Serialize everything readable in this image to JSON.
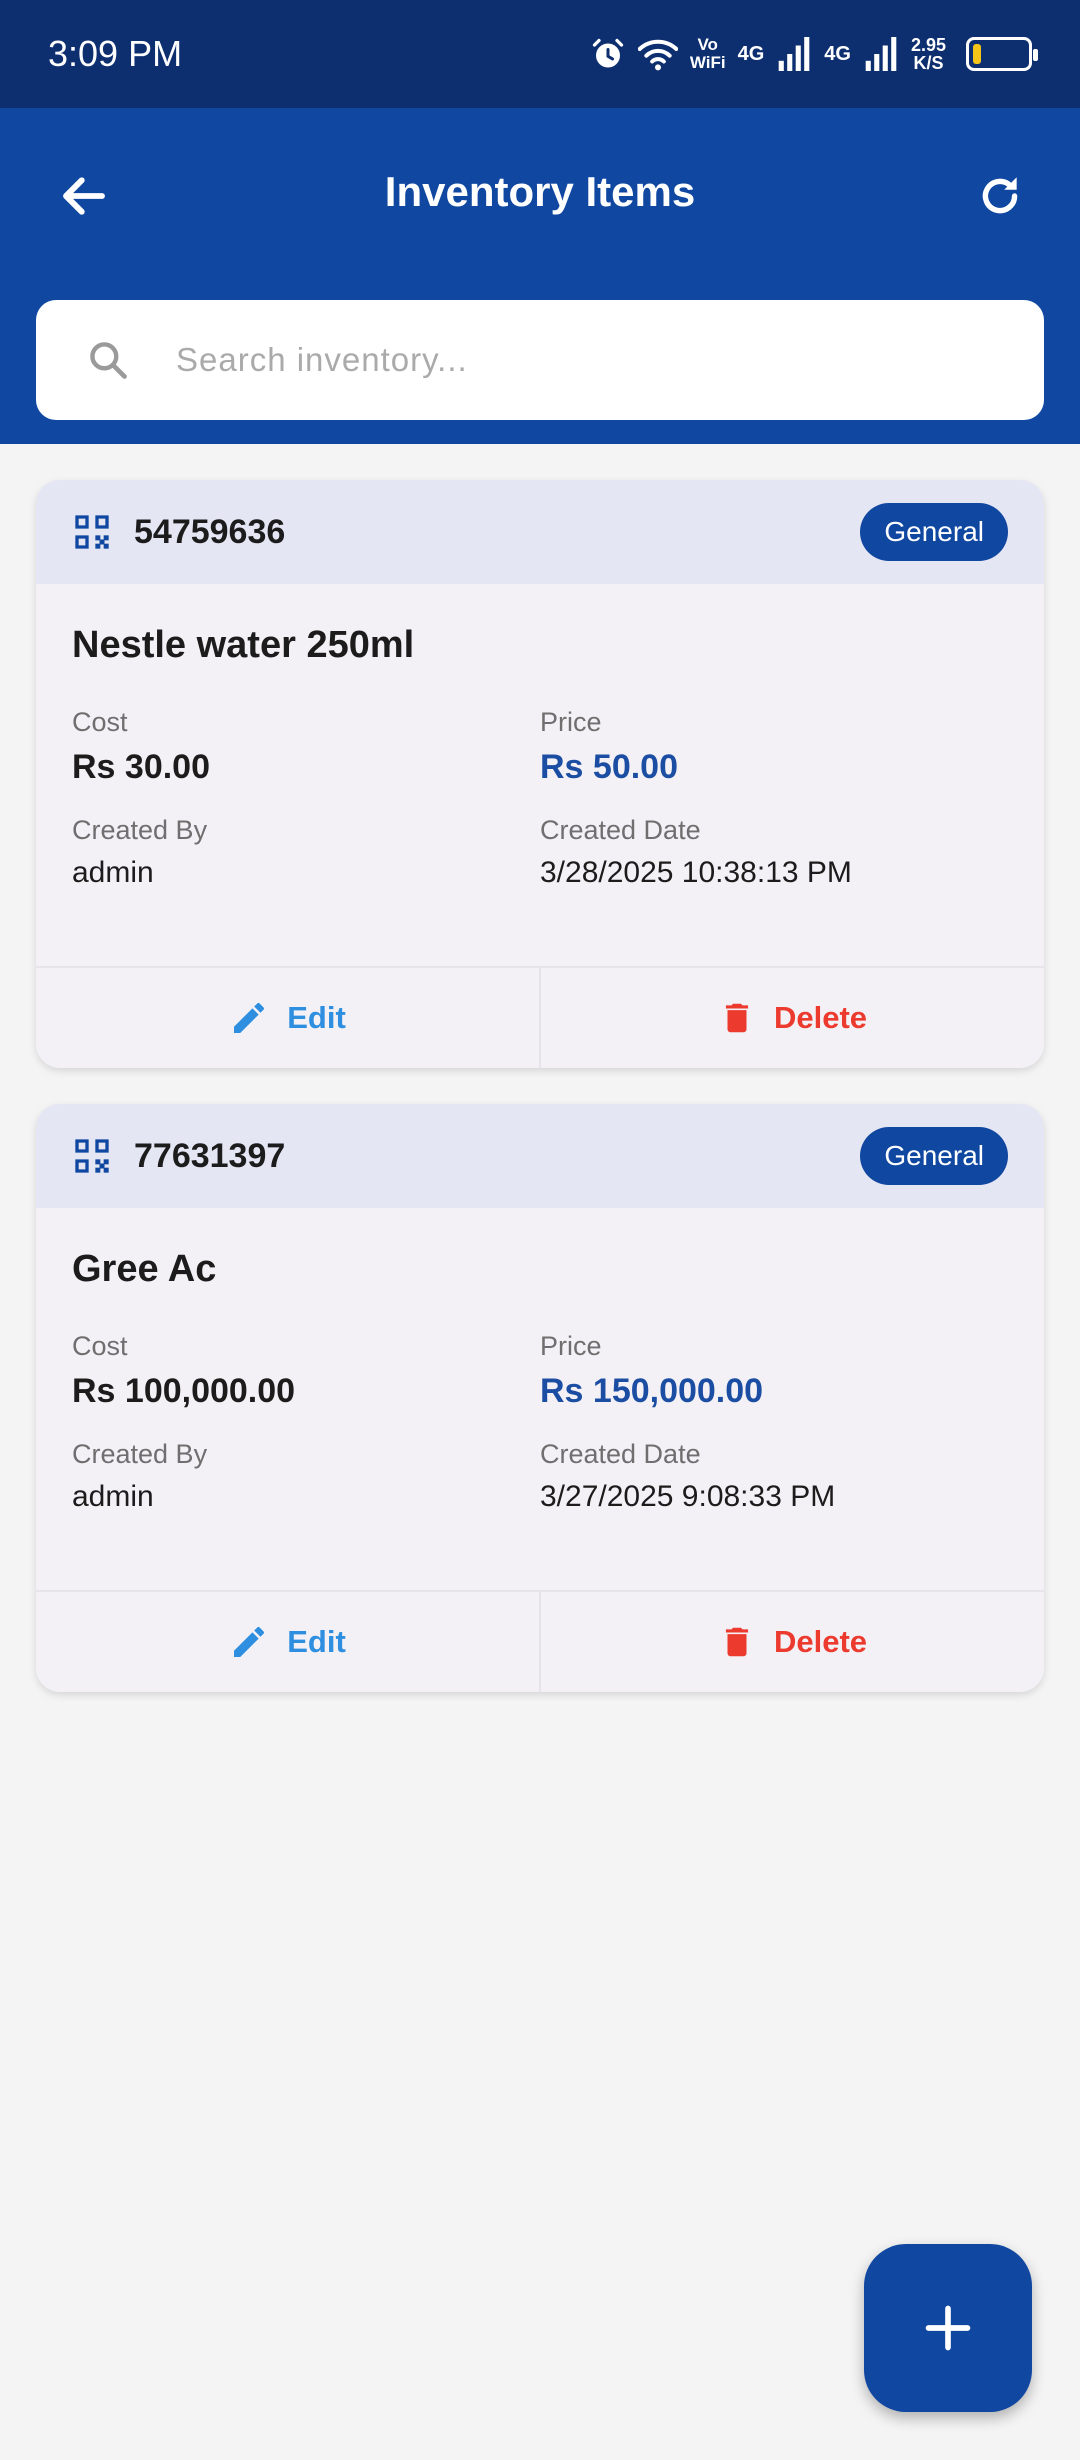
{
  "status_bar": {
    "time": "3:09 PM",
    "vo": "Vo",
    "wifi": "WiFi",
    "net1": "4G",
    "net2": "4G",
    "speed_value": "2.95",
    "speed_unit": "K/S",
    "battery_level": 0.15
  },
  "app_bar": {
    "title": "Inventory Items",
    "back_icon": "arrow-left-icon",
    "refresh_icon": "refresh-icon"
  },
  "search": {
    "placeholder": "Search inventory...",
    "value": ""
  },
  "items": [
    {
      "code": "54759636",
      "category": "General",
      "name": "Nestle water 250ml",
      "cost_label": "Cost",
      "cost": "Rs 30.00",
      "price_label": "Price",
      "price": "Rs 50.00",
      "created_by_label": "Created By",
      "created_by": "admin",
      "created_date_label": "Created Date",
      "created_date": "3/28/2025 10:38:13 PM",
      "edit_label": "Edit",
      "delete_label": "Delete"
    },
    {
      "code": "77631397",
      "category": "General",
      "name": "Gree Ac",
      "cost_label": "Cost",
      "cost": "Rs 100,000.00",
      "price_label": "Price",
      "price": "Rs 150,000.00",
      "created_by_label": "Created By",
      "created_by": "admin",
      "created_date_label": "Created Date",
      "created_date": "3/27/2025 9:08:33 PM",
      "edit_label": "Edit",
      "delete_label": "Delete"
    }
  ],
  "colors": {
    "primary": "#0f47a1",
    "status_bar": "#0d2f70",
    "edit": "#2e8fe0",
    "delete": "#ec3a2e",
    "price": "#1b4ea3"
  }
}
